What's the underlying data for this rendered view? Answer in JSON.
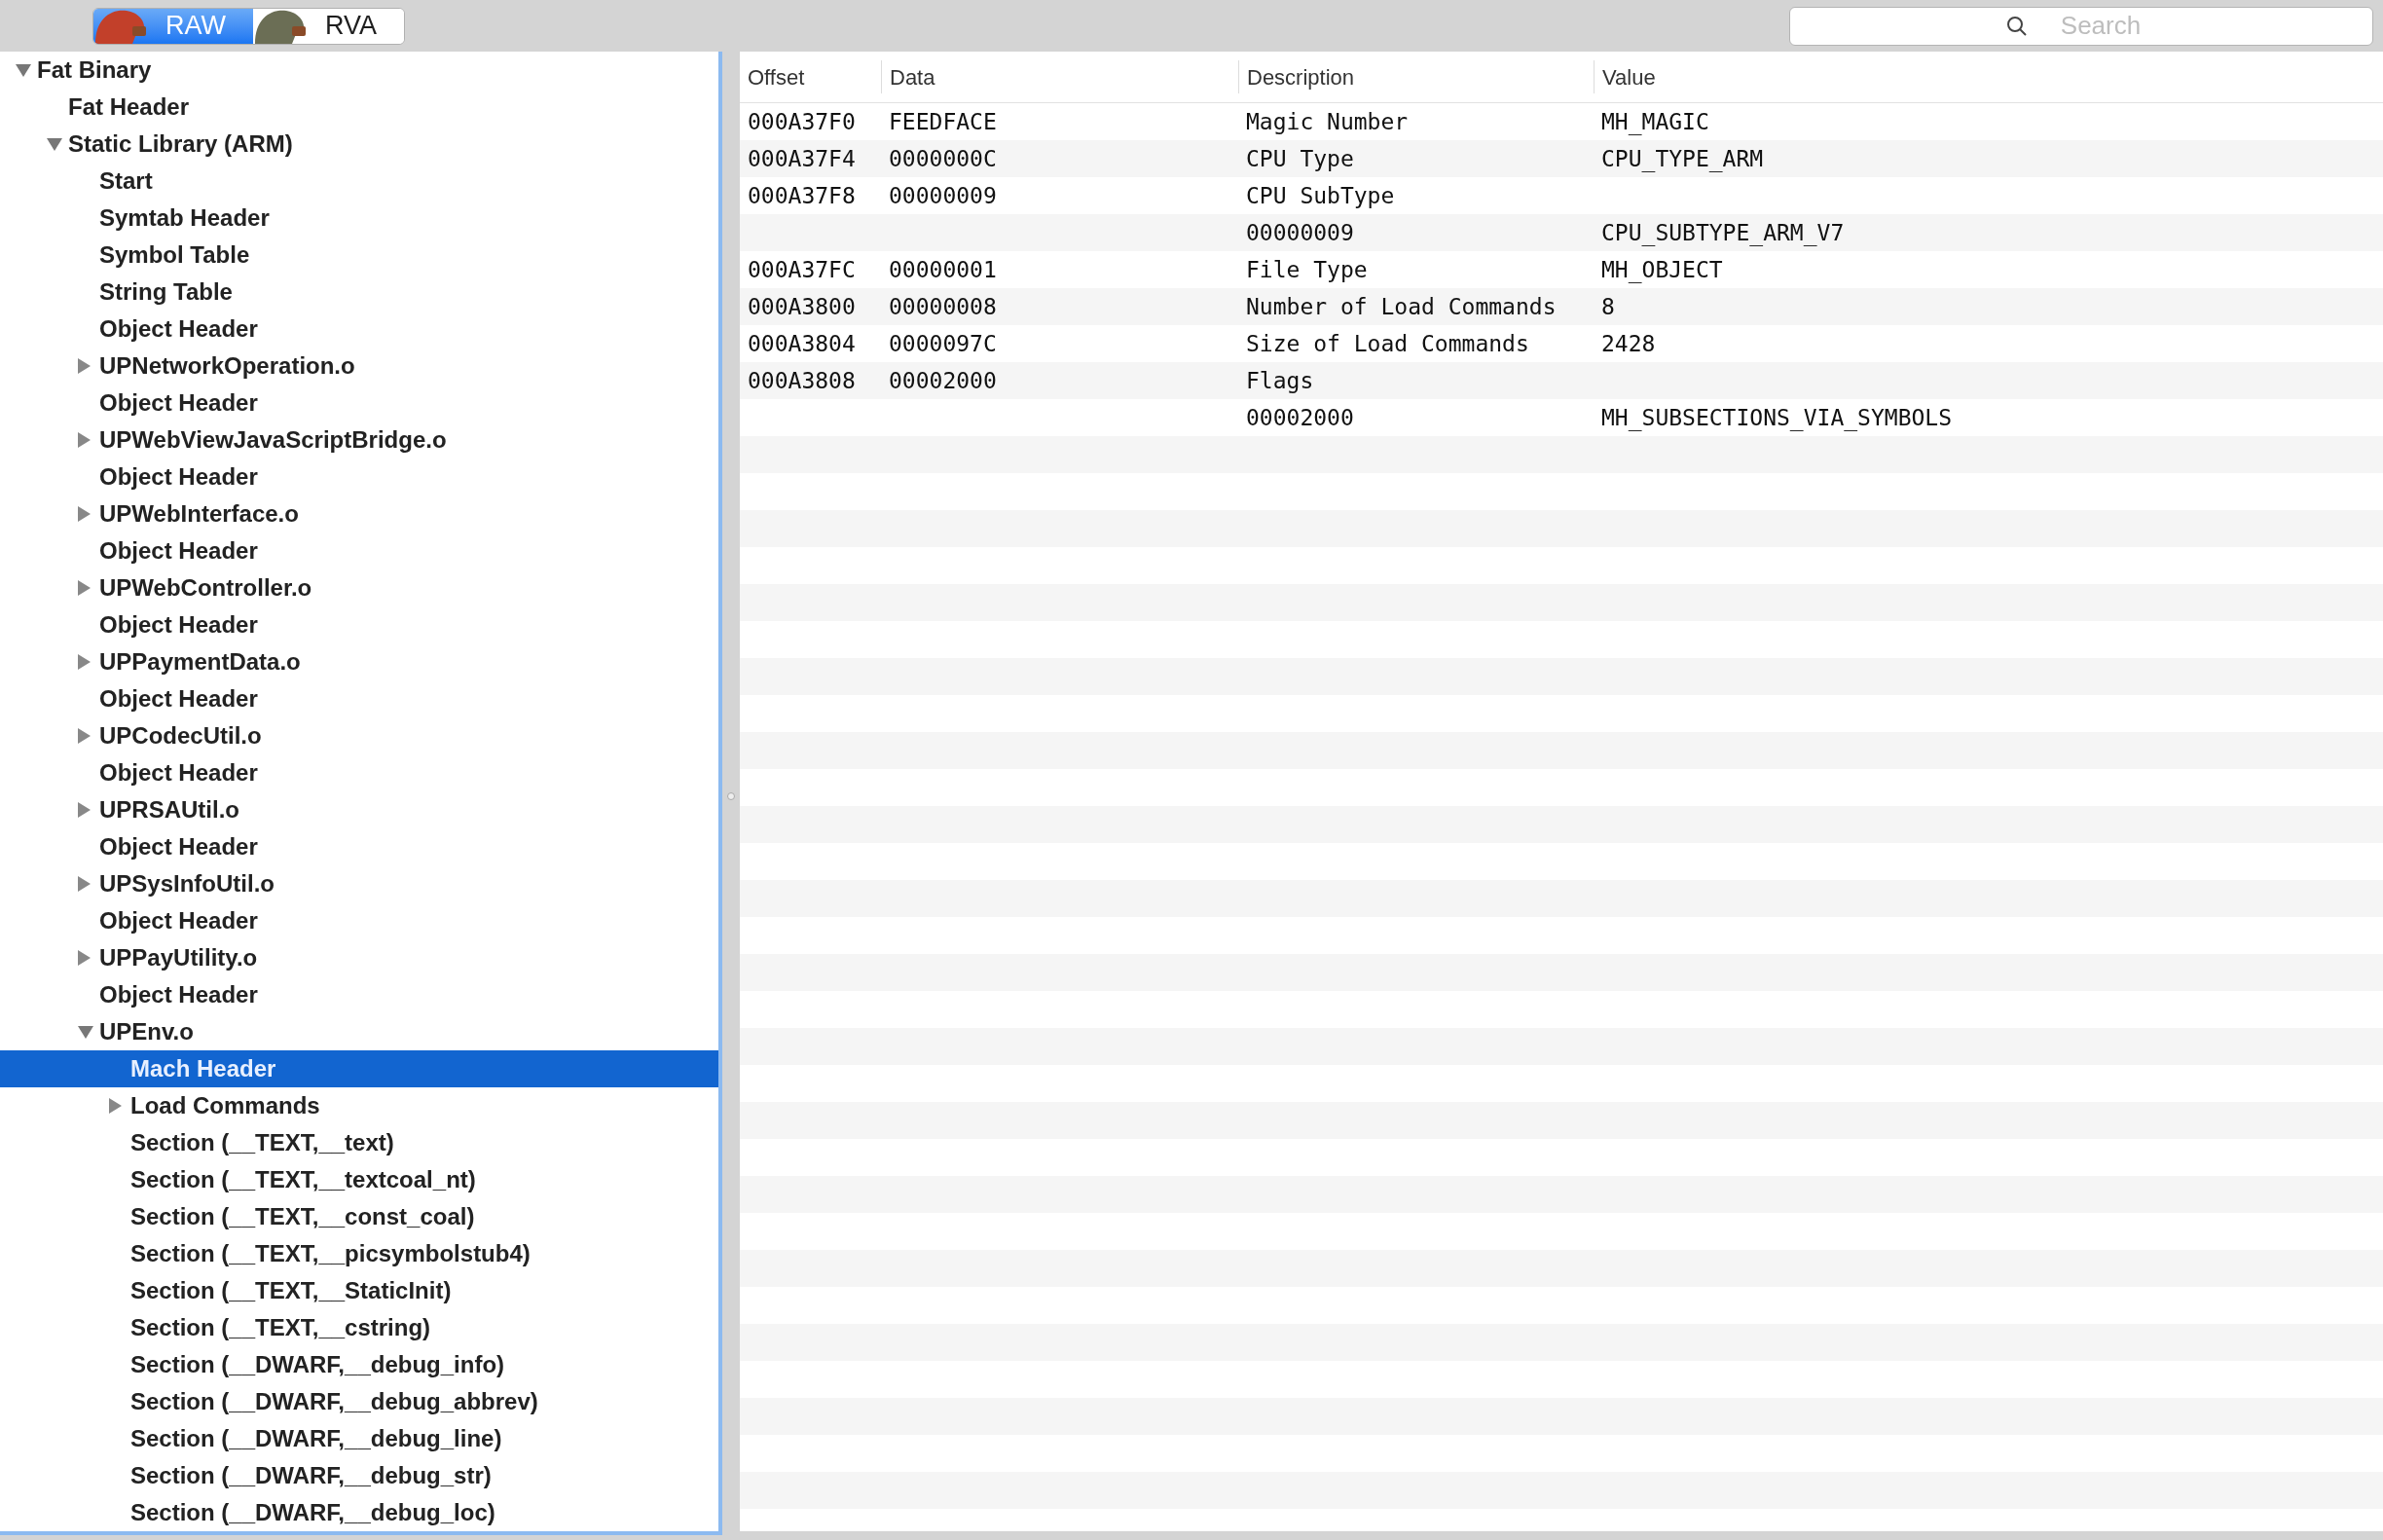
{
  "toolbar": {
    "modes": [
      {
        "label": "RAW",
        "selected": true
      },
      {
        "label": "RVA",
        "selected": false
      }
    ],
    "search": {
      "placeholder": "Search"
    }
  },
  "tree": [
    {
      "label": "Fat Binary",
      "selected": false,
      "expanded": true,
      "children": [
        {
          "label": "Fat Header",
          "selected": false
        },
        {
          "label": "Static Library (ARM)",
          "selected": false,
          "expanded": true,
          "children": [
            {
              "label": "Start",
              "selected": false
            },
            {
              "label": "Symtab Header",
              "selected": false
            },
            {
              "label": "Symbol Table",
              "selected": false
            },
            {
              "label": "String Table",
              "selected": false
            },
            {
              "label": "Object Header",
              "selected": false
            },
            {
              "label": "UPNetworkOperation.o",
              "selected": false,
              "expanded": false
            },
            {
              "label": "Object Header",
              "selected": false
            },
            {
              "label": "UPWebViewJavaScriptBridge.o",
              "selected": false,
              "expanded": false
            },
            {
              "label": "Object Header",
              "selected": false
            },
            {
              "label": "UPWebInterface.o",
              "selected": false,
              "expanded": false
            },
            {
              "label": "Object Header",
              "selected": false
            },
            {
              "label": "UPWebController.o",
              "selected": false,
              "expanded": false
            },
            {
              "label": "Object Header",
              "selected": false
            },
            {
              "label": "UPPaymentData.o",
              "selected": false,
              "expanded": false
            },
            {
              "label": "Object Header",
              "selected": false
            },
            {
              "label": "UPCodecUtil.o",
              "selected": false,
              "expanded": false
            },
            {
              "label": "Object Header",
              "selected": false
            },
            {
              "label": "UPRSAUtil.o",
              "selected": false,
              "expanded": false
            },
            {
              "label": "Object Header",
              "selected": false
            },
            {
              "label": "UPSysInfoUtil.o",
              "selected": false,
              "expanded": false
            },
            {
              "label": "Object Header",
              "selected": false
            },
            {
              "label": "UPPayUtility.o",
              "selected": false,
              "expanded": false
            },
            {
              "label": "Object Header",
              "selected": false
            },
            {
              "label": "UPEnv.o",
              "selected": false,
              "expanded": true,
              "children": [
                {
                  "label": "Mach Header",
                  "selected": true
                },
                {
                  "label": "Load Commands",
                  "selected": false,
                  "expanded": false
                },
                {
                  "label": "Section (__TEXT,__text)",
                  "selected": false
                },
                {
                  "label": "Section (__TEXT,__textcoal_nt)",
                  "selected": false
                },
                {
                  "label": "Section (__TEXT,__const_coal)",
                  "selected": false
                },
                {
                  "label": "Section (__TEXT,__picsymbolstub4)",
                  "selected": false
                },
                {
                  "label": "Section (__TEXT,__StaticInit)",
                  "selected": false
                },
                {
                  "label": "Section (__TEXT,__cstring)",
                  "selected": false
                },
                {
                  "label": "Section (__DWARF,__debug_info)",
                  "selected": false
                },
                {
                  "label": "Section (__DWARF,__debug_abbrev)",
                  "selected": false
                },
                {
                  "label": "Section (__DWARF,__debug_line)",
                  "selected": false
                },
                {
                  "label": "Section (__DWARF,__debug_str)",
                  "selected": false
                },
                {
                  "label": "Section (__DWARF,__debug_loc)",
                  "selected": false
                }
              ]
            }
          ]
        }
      ]
    }
  ],
  "table": {
    "columns": [
      "Offset",
      "Data",
      "Description",
      "Value"
    ],
    "rows": [
      {
        "offset": "000A37F0",
        "data": "FEEDFACE",
        "description": "Magic Number",
        "value": "MH_MAGIC"
      },
      {
        "offset": "000A37F4",
        "data": "0000000C",
        "description": "CPU Type",
        "value": "CPU_TYPE_ARM"
      },
      {
        "offset": "000A37F8",
        "data": "00000009",
        "description": "CPU SubType"
      },
      {
        "description": "00000009",
        "value": "CPU_SUBTYPE_ARM_V7"
      },
      {
        "offset": "000A37FC",
        "data": "00000001",
        "description": "File Type",
        "value": "MH_OBJECT"
      },
      {
        "offset": "000A3800",
        "data": "00000008",
        "description": "Number of Load Commands",
        "value": "8"
      },
      {
        "offset": "000A3804",
        "data": "0000097C",
        "description": "Size of Load Commands",
        "value": "2428"
      },
      {
        "offset": "000A3808",
        "data": "00002000",
        "description": "Flags"
      },
      {
        "description": "00002000",
        "value": "MH_SUBSECTIONS_VIA_SYMBOLS"
      }
    ]
  }
}
